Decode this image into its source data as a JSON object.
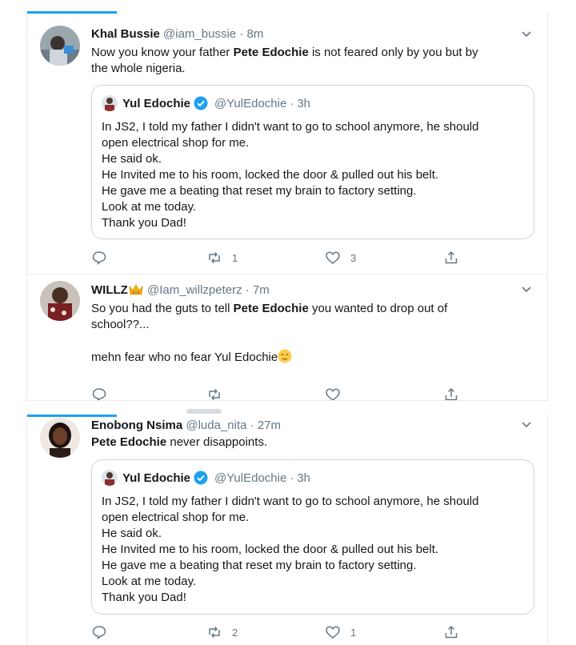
{
  "tweets": [
    {
      "name": "Khal Bussie",
      "handle": "@iam_bussie",
      "dot": "·",
      "time": "8m",
      "text_before": "Now you know your father ",
      "bold": "Pete Edochie",
      "text_after_1": " is not feared only by you but by",
      "text_line2": "the whole nigeria.",
      "actions": {
        "reply": "",
        "retweet": "1",
        "like": "3"
      }
    },
    {
      "name": "WILLZ",
      "name_badge": "crown-emoji",
      "handle": "@Iam_willzpeterz",
      "dot": "·",
      "time": "7m",
      "line1_before": "So you had the guts to tell ",
      "line1_bold": "Pete Edochie",
      "line1_after": " you wanted to drop out of",
      "line2": "school??...",
      "line3": "mehn fear who no fear Yul Edochie",
      "line3_emoji": "relieved-face-emoji",
      "actions": {
        "reply": "",
        "retweet": "",
        "like": ""
      }
    },
    {
      "name": "Enobong Nsima",
      "handle": "@luda_nita",
      "dot": "·",
      "time": "27m",
      "bold": "Pete Edochie",
      "text_after": " never disappoints.",
      "actions": {
        "reply": "",
        "retweet": "2",
        "like": "1"
      }
    }
  ],
  "quoted": {
    "name": "Yul Edochie",
    "handle": "@YulEdochie",
    "dot": "·",
    "time": "3h",
    "lines": [
      "In JS2, I told my father I didn't want to go to school anymore, he should",
      "open electrical shop for me.",
      "He said ok.",
      "He Invited me to his room, locked the door & pulled out his belt.",
      "He gave me a beating that reset my brain to factory setting.",
      "Look at me today.",
      "Thank you Dad!"
    ]
  },
  "colors": {
    "accent": "#1da1f2",
    "text": "#14171a",
    "secondary": "#657786",
    "border": "#e6ecf0"
  }
}
